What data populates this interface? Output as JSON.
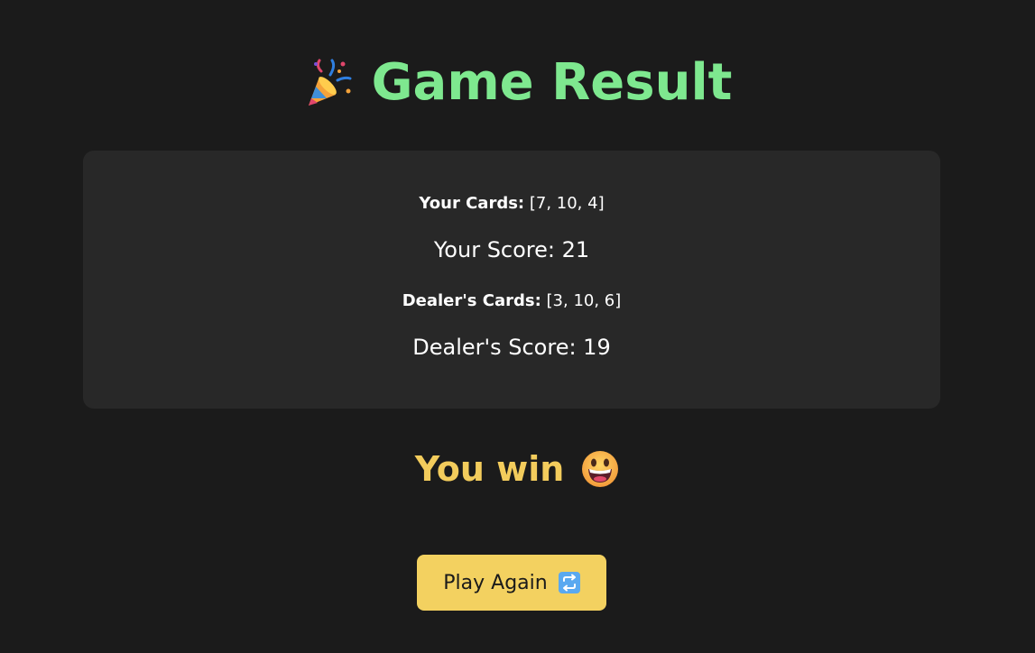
{
  "header": {
    "title": "Game Result",
    "icon": "party-popper-icon"
  },
  "summary": {
    "your_cards_label": "Your Cards:",
    "your_cards_value": "[7, 10, 4]",
    "your_score": "Your Score: 21",
    "dealer_cards_label": "Dealer's Cards:",
    "dealer_cards_value": "[3, 10, 6]",
    "dealer_score": "Dealer's Score: 19"
  },
  "result": {
    "text": "You win",
    "icon": "grinning-face-icon"
  },
  "actions": {
    "play_again_label": "Play Again",
    "play_again_icon": "repeat-icon"
  },
  "colors": {
    "background": "#1b1b1b",
    "card": "#282828",
    "title": "#7ee88f",
    "result": "#f3cc5c",
    "button": "#f3d160"
  }
}
